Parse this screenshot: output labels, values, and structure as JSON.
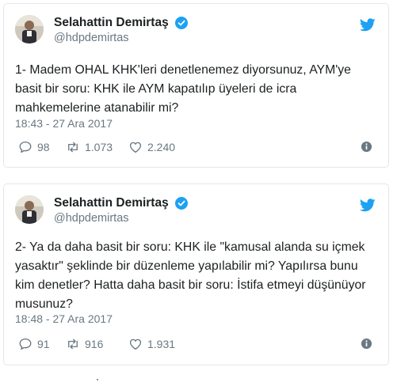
{
  "colors": {
    "brand": "#1da1f2",
    "text": "#1c2022",
    "muted": "#697882",
    "border": "#e1e8ed"
  },
  "icons": {
    "verified": "verified-badge-icon",
    "logo": "twitter-bird-icon",
    "reply": "reply-bubble-icon",
    "retweet": "retweet-icon",
    "like": "heart-icon",
    "info": "info-icon"
  },
  "tweets": [
    {
      "author": {
        "name": "Selahattin Demirtaş",
        "handle": "@hdpdemirtas"
      },
      "text": "1- Madem OHAL KHK'leri denetlenemez diyorsunuz, AYM'ye basit bir soru: KHK ile AYM kapatılıp üyeleri de icra mahkemelerine atanabilir mi?",
      "timestamp": "18:43 - 27 Ara 2017",
      "replies": "98",
      "retweets": "1.073",
      "likes": "2.240"
    },
    {
      "author": {
        "name": "Selahattin Demirtaş",
        "handle": "@hdpdemirtas"
      },
      "text": "2- Ya da daha basit bir soru: KHK ile \"kamusal alanda su içmek yasaktır\" şeklinde bir düzenleme yapılabilir mi? Yapılırsa bunu kim denetler? Hatta daha basit bir soru: İstifa etmeyi düşünüyor musunuz?",
      "timestamp": "18:48 - 27 Ara 2017",
      "replies": "91",
      "retweets": "916",
      "likes": "1.931"
    }
  ]
}
